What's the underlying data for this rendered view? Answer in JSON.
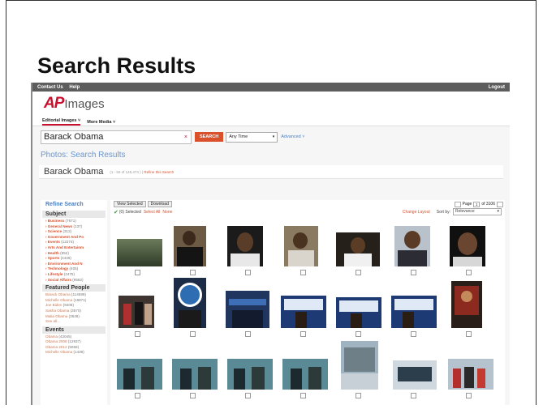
{
  "slide": {
    "title": "Search Results"
  },
  "topbar": {
    "links": [
      "Contact Us",
      "Help"
    ],
    "logout": "Logout"
  },
  "logo": {
    "ap": "AP",
    "images": "Images"
  },
  "nav": {
    "tabs": [
      "Editorial Images ˅",
      "More Media ˅"
    ]
  },
  "search": {
    "query": "Barack Obama",
    "clear_icon": "×",
    "button": "SEARCH",
    "time_filter": "Any Time",
    "advanced": "Advanced ˅"
  },
  "results": {
    "heading": "Photos: Search Results",
    "query_label": "Barack Obama",
    "meta": "(1 - 50 of 145,474 )",
    "refine_link": "Refine this Search"
  },
  "actions": {
    "view_selected": "View Selected",
    "download": "Download",
    "selected_count": "(0) Selected",
    "select_all": "Select All",
    "none": "None",
    "page_label": "Page",
    "page_value": "1",
    "page_total": "of 3106",
    "change_layout": "Change Layout",
    "sort_label": "Sort by:",
    "sort_value": "Relevance"
  },
  "sidebar": {
    "title": "Refine Search",
    "sections": [
      {
        "name": "Subject",
        "items": [
          {
            "label": "Business",
            "count": "(7671)"
          },
          {
            "label": "General News",
            "count": "(137)"
          },
          {
            "label": "Science",
            "count": "(312)"
          },
          {
            "label": "Government And Po",
            "count": ""
          },
          {
            "label": "Events",
            "count": "(12274)"
          },
          {
            "label": "Arts And Entertainm",
            "count": ""
          },
          {
            "label": "Health",
            "count": "(952)"
          },
          {
            "label": "Sports",
            "count": "(4448)"
          },
          {
            "label": "Environment And N",
            "count": ""
          },
          {
            "label": "Technology",
            "count": "(405)"
          },
          {
            "label": "Lifestyle",
            "count": "(2475)"
          },
          {
            "label": "Social Affairs",
            "count": "(9582)"
          }
        ]
      },
      {
        "name": "Featured People",
        "items": [
          {
            "label": "Barack Obama",
            "count": "(114599)"
          },
          {
            "label": "Michelle Obama",
            "count": "(16871)"
          },
          {
            "label": "Joe Biden",
            "count": "(9408)"
          },
          {
            "label": "Sasha Obama",
            "count": "(3570)"
          },
          {
            "label": "Malia Obama",
            "count": "(3548)"
          },
          {
            "label": "See all...",
            "count": ""
          }
        ]
      },
      {
        "name": "Events",
        "items": [
          {
            "label": "Obama",
            "count": "(42045)"
          },
          {
            "label": "Obama 2008",
            "count": "(12937)"
          },
          {
            "label": "Obama 2012",
            "count": "(5059)"
          },
          {
            "label": "Michelle Obama",
            "count": "(1439)"
          }
        ]
      }
    ]
  },
  "colors": {
    "accent": "#d9502b",
    "link": "#4b7fc0",
    "brand_red": "#c8102e"
  }
}
